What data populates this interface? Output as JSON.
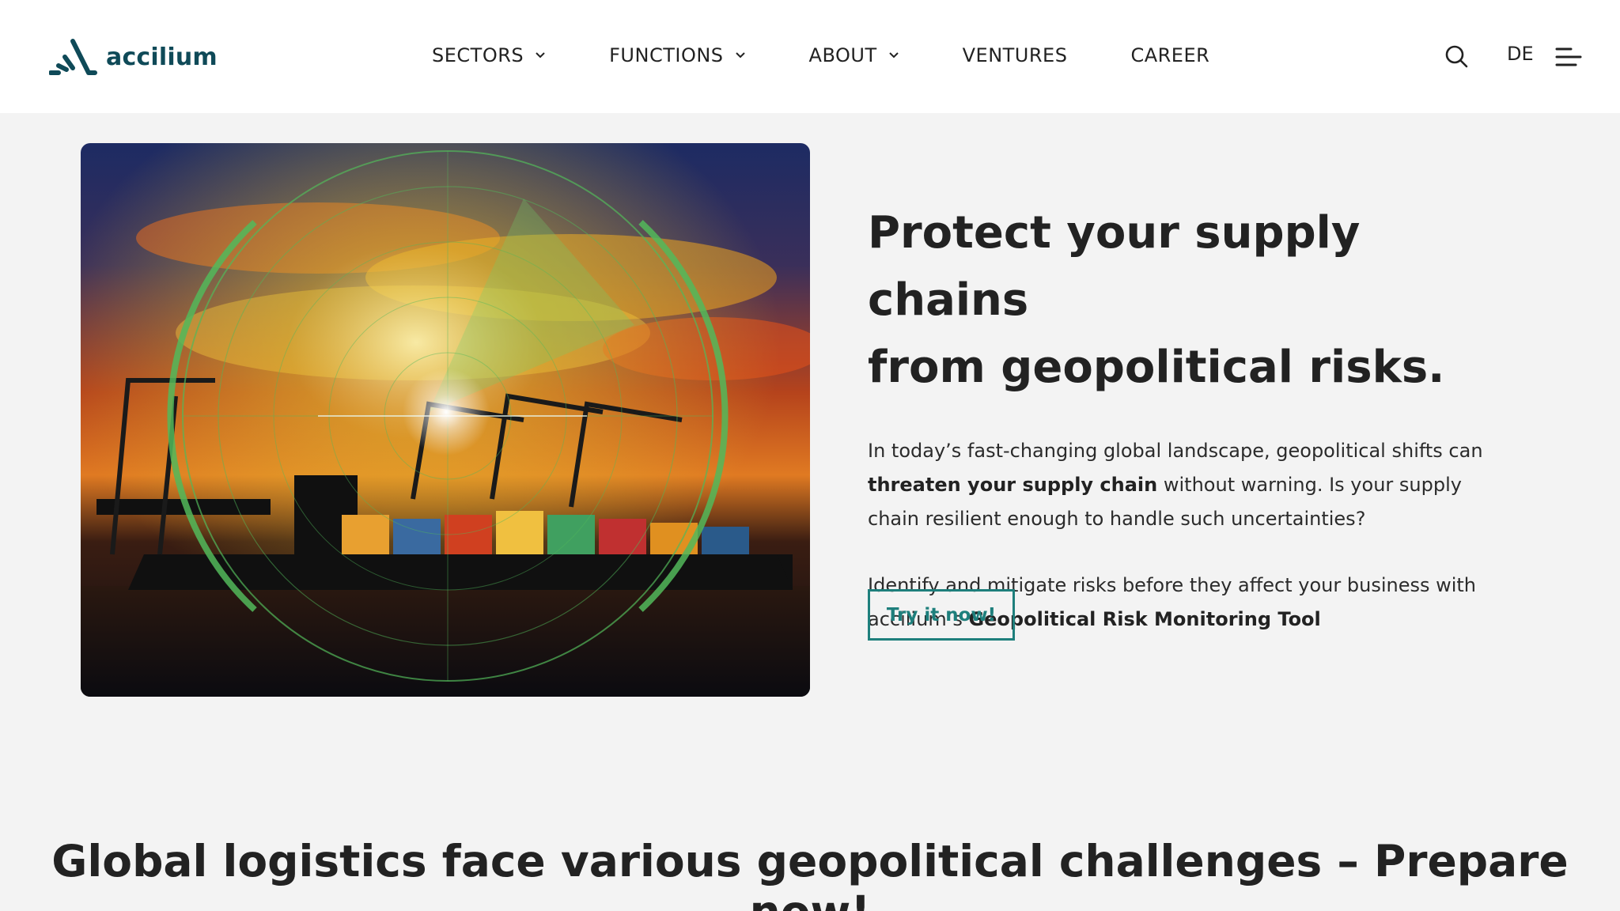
{
  "brand": {
    "name": "accilium",
    "color": "#0f4a58"
  },
  "nav": {
    "items": [
      {
        "label": "SECTORS",
        "has_dropdown": true
      },
      {
        "label": "FUNCTIONS",
        "has_dropdown": true
      },
      {
        "label": "ABOUT",
        "has_dropdown": true
      },
      {
        "label": "VENTURES",
        "has_dropdown": false
      },
      {
        "label": "CAREER",
        "has_dropdown": false
      }
    ],
    "language": "DE",
    "icons": [
      "search-icon",
      "menu-icon"
    ]
  },
  "hero": {
    "image_icon": "radar-container-ship-image",
    "title_line1": "Protect your supply chains",
    "title_line2": "from geopolitical risks.",
    "p1_pre": "In today’s fast-changing global landscape, geopolitical shifts can ",
    "p1_bold": "threaten your supply chain",
    "p1_post": " without warning. Is your supply chain resilient enough to handle such uncertainties?",
    "p2_pre": "Identify and mitigate risks before they affect your business with accilium’s ",
    "p2_bold": "Geopolitical Risk Monitoring Tool",
    "cta_label": "Try it now!"
  },
  "section": {
    "title": "Global logistics face various geopolitical challenges – Prepare now!"
  },
  "colors": {
    "accent": "#1e7f7c",
    "background": "#f3f3f3",
    "header": "#ffffff",
    "text": "#222222"
  }
}
